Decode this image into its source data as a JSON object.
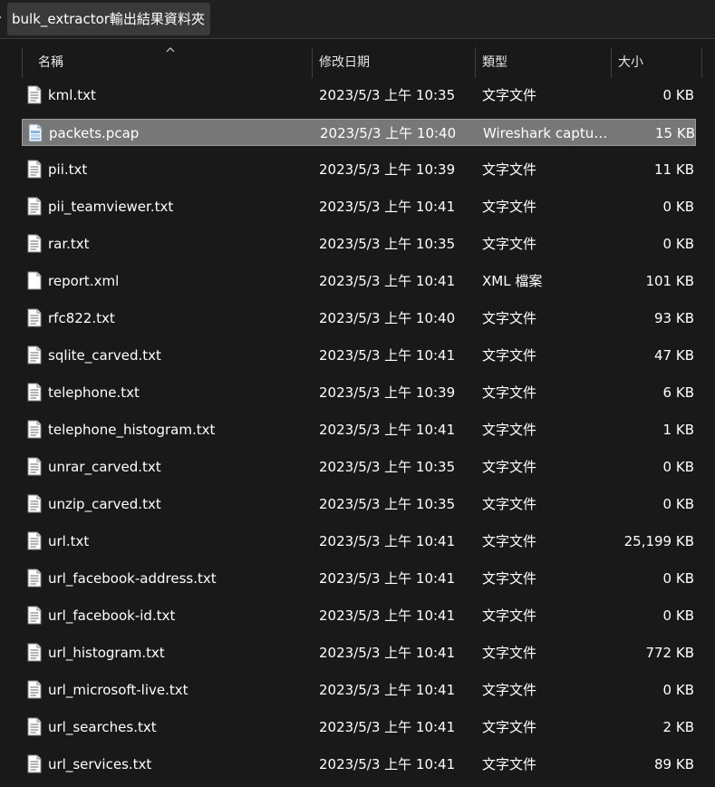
{
  "breadcrumb": {
    "folder": "bulk_extractor輸出結果資料夾"
  },
  "columns": {
    "name": "名稱",
    "date": "修改日期",
    "type": "類型",
    "size": "大小"
  },
  "files": [
    {
      "name": "kml.txt",
      "date": "2023/5/3 上午 10:35",
      "type": "文字文件",
      "size": "0 KB",
      "icon": "text-file-icon"
    },
    {
      "name": "packets.pcap",
      "date": "2023/5/3 上午 10:40",
      "type": "Wireshark captur...",
      "size": "15 KB",
      "icon": "pcap-file-icon",
      "selected": true
    },
    {
      "name": "pii.txt",
      "date": "2023/5/3 上午 10:39",
      "type": "文字文件",
      "size": "11 KB",
      "icon": "text-file-icon"
    },
    {
      "name": "pii_teamviewer.txt",
      "date": "2023/5/3 上午 10:41",
      "type": "文字文件",
      "size": "0 KB",
      "icon": "text-file-icon"
    },
    {
      "name": "rar.txt",
      "date": "2023/5/3 上午 10:35",
      "type": "文字文件",
      "size": "0 KB",
      "icon": "text-file-icon"
    },
    {
      "name": "report.xml",
      "date": "2023/5/3 上午 10:41",
      "type": "XML 檔案",
      "size": "101 KB",
      "icon": "xml-file-icon"
    },
    {
      "name": "rfc822.txt",
      "date": "2023/5/3 上午 10:40",
      "type": "文字文件",
      "size": "93 KB",
      "icon": "text-file-icon"
    },
    {
      "name": "sqlite_carved.txt",
      "date": "2023/5/3 上午 10:41",
      "type": "文字文件",
      "size": "47 KB",
      "icon": "text-file-icon"
    },
    {
      "name": "telephone.txt",
      "date": "2023/5/3 上午 10:39",
      "type": "文字文件",
      "size": "6 KB",
      "icon": "text-file-icon"
    },
    {
      "name": "telephone_histogram.txt",
      "date": "2023/5/3 上午 10:41",
      "type": "文字文件",
      "size": "1 KB",
      "icon": "text-file-icon"
    },
    {
      "name": "unrar_carved.txt",
      "date": "2023/5/3 上午 10:35",
      "type": "文字文件",
      "size": "0 KB",
      "icon": "text-file-icon"
    },
    {
      "name": "unzip_carved.txt",
      "date": "2023/5/3 上午 10:35",
      "type": "文字文件",
      "size": "0 KB",
      "icon": "text-file-icon"
    },
    {
      "name": "url.txt",
      "date": "2023/5/3 上午 10:41",
      "type": "文字文件",
      "size": "25,199 KB",
      "icon": "text-file-icon"
    },
    {
      "name": "url_facebook-address.txt",
      "date": "2023/5/3 上午 10:41",
      "type": "文字文件",
      "size": "0 KB",
      "icon": "text-file-icon"
    },
    {
      "name": "url_facebook-id.txt",
      "date": "2023/5/3 上午 10:41",
      "type": "文字文件",
      "size": "0 KB",
      "icon": "text-file-icon"
    },
    {
      "name": "url_histogram.txt",
      "date": "2023/5/3 上午 10:41",
      "type": "文字文件",
      "size": "772 KB",
      "icon": "text-file-icon"
    },
    {
      "name": "url_microsoft-live.txt",
      "date": "2023/5/3 上午 10:41",
      "type": "文字文件",
      "size": "0 KB",
      "icon": "text-file-icon"
    },
    {
      "name": "url_searches.txt",
      "date": "2023/5/3 上午 10:41",
      "type": "文字文件",
      "size": "2 KB",
      "icon": "text-file-icon"
    },
    {
      "name": "url_services.txt",
      "date": "2023/5/3 上午 10:41",
      "type": "文字文件",
      "size": "89 KB",
      "icon": "text-file-icon"
    }
  ],
  "colors": {
    "background": "#191919",
    "selected_row": "#777777",
    "text": "#ffffff"
  }
}
